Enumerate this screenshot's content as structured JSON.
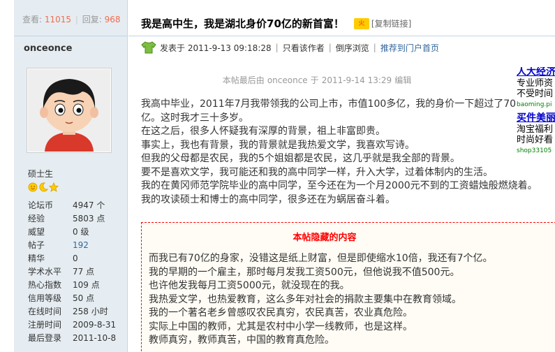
{
  "stats": {
    "views_label": "查看:",
    "views": "11015",
    "replies_label": "回复:",
    "replies": "968"
  },
  "author": {
    "name": "onceonce",
    "rank": "硕士生"
  },
  "profile": [
    {
      "k": "论坛币",
      "v": "4947 个",
      "link": false
    },
    {
      "k": "经验",
      "v": "5803 点",
      "link": false
    },
    {
      "k": "威望",
      "v": "0 级",
      "link": false
    },
    {
      "k": "帖子",
      "v": "192",
      "link": true
    },
    {
      "k": "精华",
      "v": "0",
      "link": false
    },
    {
      "k": "学术水平",
      "v": "77 点",
      "link": false
    },
    {
      "k": "热心指数",
      "v": "109 点",
      "link": false
    },
    {
      "k": "信用等级",
      "v": "50 点",
      "link": false
    },
    {
      "k": "在线时间",
      "v": "258 小时",
      "link": false
    },
    {
      "k": "注册时间",
      "v": "2009-8-31",
      "link": false
    },
    {
      "k": "最后登录",
      "v": "2011-10-8",
      "link": false
    }
  ],
  "thread": {
    "title": "我是高中生，我是湖北身价70亿的新首富！",
    "hot_badge": "火",
    "copy_link": "[复制链接]"
  },
  "meta": {
    "posted": "发表于 2011-9-13 09:18:28",
    "only_author": "只看该作者",
    "reverse": "倒序浏览",
    "recommend": "推荐到门户首页"
  },
  "edit_note": {
    "prefix": "本帖最后由",
    "user": "onceonce",
    "mid": "于",
    "time": "2011-9-14 13:29",
    "suffix": "编辑"
  },
  "body": [
    "我高中毕业，2011年7月我带领我的公司上市，市值100多亿，我的身价一下超过了70",
    "亿。这时我才三十多岁。",
    "在这之后，很多人怀疑我有深厚的背景，祖上非富即贵。",
    "事实上，我也有背景，我的背景就是我热爱文学，我喜欢写诗。",
    "但我的父母都是农民，我的5个姐姐都是农民，这几乎就是我全部的背景。",
    "要不是喜欢文学，我可能还和我的高中同学一样，升入大学，过着体制内的生活。",
    "我的在黄冈师范学院毕业的高中同学，至今还在为一个月2000元不到的工资蜡烛般燃烧着。",
    "我的攻读硕士和博士的高中同学，很多还在为蜗居奋斗着。"
  ],
  "hidden": {
    "title": "本帖隐藏的内容",
    "lines": [
      "而我已有70亿的身家，没错这是纸上财富，但是即使缩水10倍，我还有7个亿。",
      "我的早期的一个雇主，那时每月发我工资500元，但他说我不值500元。",
      "也许他发我每月工资5000元，就没现在的我。",
      "我热爱文学，也热爱教育，这么多年对社会的捐款主要集中在教育领域。",
      "我的一个著名老乡曾感叹农民真穷，农民真苦，农业真危险。",
      "实际上中国的教师，尤其是农村中小学一线教师，也是这样。",
      "教师真穷，教师真苦，中国的教育真危险。"
    ]
  },
  "ads": [
    {
      "title": "人大经济",
      "lines": [
        "专业师资",
        "不受时间"
      ],
      "url": "baoming.pi"
    },
    {
      "title": "买件美丽",
      "lines": [
        "淘宝福利",
        "时尚好看"
      ],
      "url": "shop33105"
    }
  ],
  "colors": {
    "accent": "#f26c4f",
    "link": "#336699",
    "border": "#c2d5e3",
    "sidebar": "#e5edf2",
    "hidden_border": "#ff0000"
  }
}
